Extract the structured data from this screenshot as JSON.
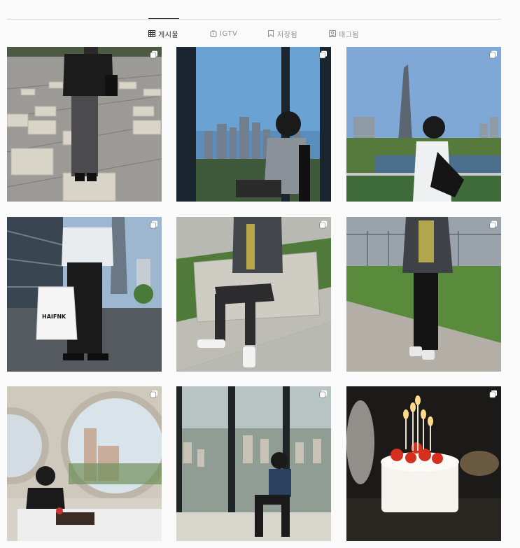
{
  "tabs": [
    {
      "label": "게시물",
      "icon": "grid-icon",
      "active": true
    },
    {
      "label": "IGTV",
      "icon": "igtv-icon",
      "active": false
    },
    {
      "label": "저장됨",
      "icon": "bookmark-icon",
      "active": false
    },
    {
      "label": "태그됨",
      "icon": "tagged-icon",
      "active": false
    }
  ],
  "posts": [
    {
      "scene": "rooftop-concrete-blocks",
      "multiple": true
    },
    {
      "scene": "window-city-skyline",
      "multiple": true
    },
    {
      "scene": "tower-river-park",
      "multiple": true
    },
    {
      "scene": "glass-building-shopping-bag",
      "multiple": true
    },
    {
      "scene": "seated-on-stone-bench",
      "multiple": true
    },
    {
      "scene": "rooftop-lawn-standing",
      "multiple": true
    },
    {
      "scene": "round-window-dining",
      "multiple": true
    },
    {
      "scene": "high-floor-window-city",
      "multiple": true
    },
    {
      "scene": "birthday-cake-candles",
      "multiple": true
    }
  ],
  "shopping_bag_text": "HAIFNK",
  "colors": {
    "active_tab": "#262626",
    "inactive_tab": "#8e8e8e",
    "divider": "#dbdbdb",
    "background": "#fafafa"
  }
}
